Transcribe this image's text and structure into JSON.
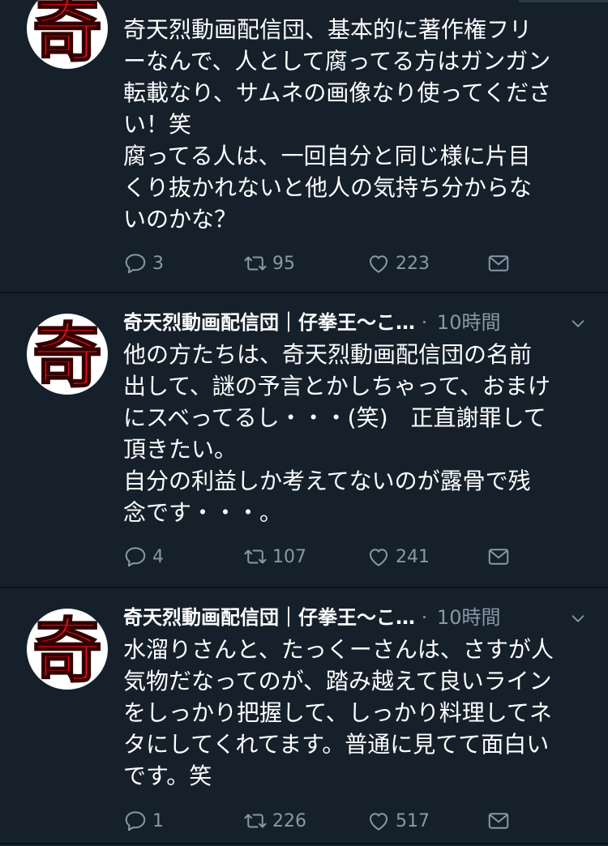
{
  "colors": {
    "background": "#15202b",
    "muted": "#8899a6",
    "divider": "#0b1117",
    "avatar_red": "#e0101a"
  },
  "tweets": [
    {
      "author": "",
      "time": "",
      "lines": [
        "奇天烈動画配信団、基本的に著作権フリ",
        "ーなんで、人として腐ってる方はガンガン",
        "転載なり、サムネの画像なり使ってくださ",
        "い！笑",
        "腐ってる人は、一回自分と同じ様に片目",
        "くり抜かれないと他人の気持ち分からな",
        "いのかな？"
      ],
      "reply_count": "3",
      "retweet_count": "95",
      "like_count": "223"
    },
    {
      "author": "奇天烈動画配信団｜仔拳王〜こ…",
      "dot": "·",
      "time": "10時間",
      "lines": [
        "他の方たちは、奇天烈動画配信団の名前",
        "出して、謎の予言とかしちゃって、おまけ",
        "にスベってるし・・・(笑)　正直謝罪して",
        "頂きたい。",
        "自分の利益しか考えてないのが露骨で残",
        "念です・・・。"
      ],
      "reply_count": "4",
      "retweet_count": "107",
      "like_count": "241"
    },
    {
      "author": "奇天烈動画配信団｜仔拳王〜こ…",
      "dot": "·",
      "time": "10時間",
      "lines": [
        "水溜りさんと、たっくーさんは、さすが人",
        "気物だなってのが、踏み越えて良いライン",
        "をしっかり把握して、しっかり料理してネ",
        "タにしてくれてます。普通に見てて面白い",
        "です。笑"
      ],
      "reply_count": "1",
      "retweet_count": "226",
      "like_count": "517"
    }
  ],
  "icons": {
    "avatar_glyph": "奇",
    "reply": "reply-icon",
    "retweet": "retweet-icon",
    "like": "heart-icon",
    "share": "share-icon",
    "caret": "chevron-down-icon"
  }
}
